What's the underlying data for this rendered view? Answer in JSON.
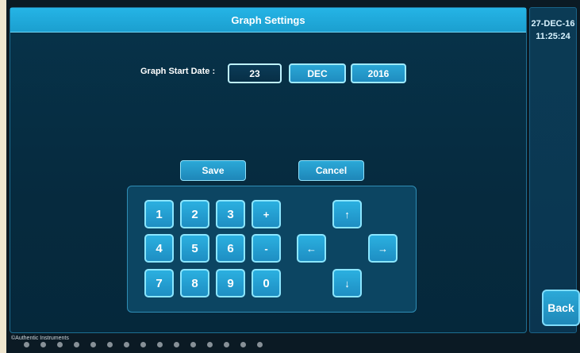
{
  "header": {
    "title": "Graph Settings"
  },
  "clock": {
    "date": "27-DEC-16",
    "time": "11:25:24"
  },
  "form": {
    "start_date_label": "Graph Start Date :",
    "day": "23",
    "month": "DEC",
    "year": "2016"
  },
  "actions": {
    "save_label": "Save",
    "cancel_label": "Cancel"
  },
  "keypad": {
    "digits": [
      "1",
      "2",
      "3",
      "4",
      "5",
      "6",
      "7",
      "8",
      "9",
      "0"
    ],
    "plus": "+",
    "minus": "-",
    "arrows": {
      "up": "↑",
      "left": "←",
      "right": "→",
      "down": "↓"
    }
  },
  "nav": {
    "back_label": "Back"
  },
  "footer": {
    "copyright": "©Authentic Instruments"
  },
  "colors": {
    "accent": "#1fa3d6",
    "screen_bg": "#06304a",
    "key_border": "#8be6ff"
  }
}
